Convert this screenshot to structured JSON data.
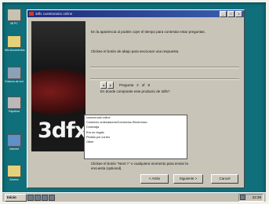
{
  "desktop": {
    "icons": [
      {
        "name": "Mi PC",
        "icon": "computer-icon"
      },
      {
        "name": "Mis documentos",
        "icon": "folder-icon"
      },
      {
        "name": "Entorno de red",
        "icon": "network-icon"
      },
      {
        "name": "Papelera",
        "icon": "recycle-bin-icon"
      },
      {
        "name": "Internet",
        "icon": "globe-icon"
      },
      {
        "name": "Acceso",
        "icon": "folder-icon"
      }
    ]
  },
  "window": {
    "title": "3dfx cuestionario online",
    "minimize": "_",
    "maximize": "□",
    "close": "×"
  },
  "banner": {
    "logo": "3dfx"
  },
  "content": {
    "intro": "En la apariencia ul podeis cojer el tiempo para contestar estar preguntas.",
    "instruction": "Clickee el botón de abajo para seccionar una respuesta.",
    "question_label": "Pregunta",
    "question_number": "2",
    "question_of": "of",
    "question_total": "9",
    "question": "En donde compraste este producto de 3dfx?",
    "answers": [
      "commercial online",
      "Comercio ordenadores/Comercios Electrónico",
      "Comcraja",
      "Era un regalo",
      "Pedido por correo",
      "Other"
    ],
    "footer": "Clickee el botón \"Next >\" o cualquiera momento para enviar la encuesta (optional).",
    "back_label": "< Atrás",
    "next_label": "Siguiente >",
    "cancel_label": "Cancel"
  },
  "taskbar": {
    "start_label": "Inicio",
    "clock": "22:38"
  },
  "colors": {
    "desktop": "#0f6f7a",
    "titlebar": "#1d2b78",
    "dialog": "#c8c4b8"
  }
}
